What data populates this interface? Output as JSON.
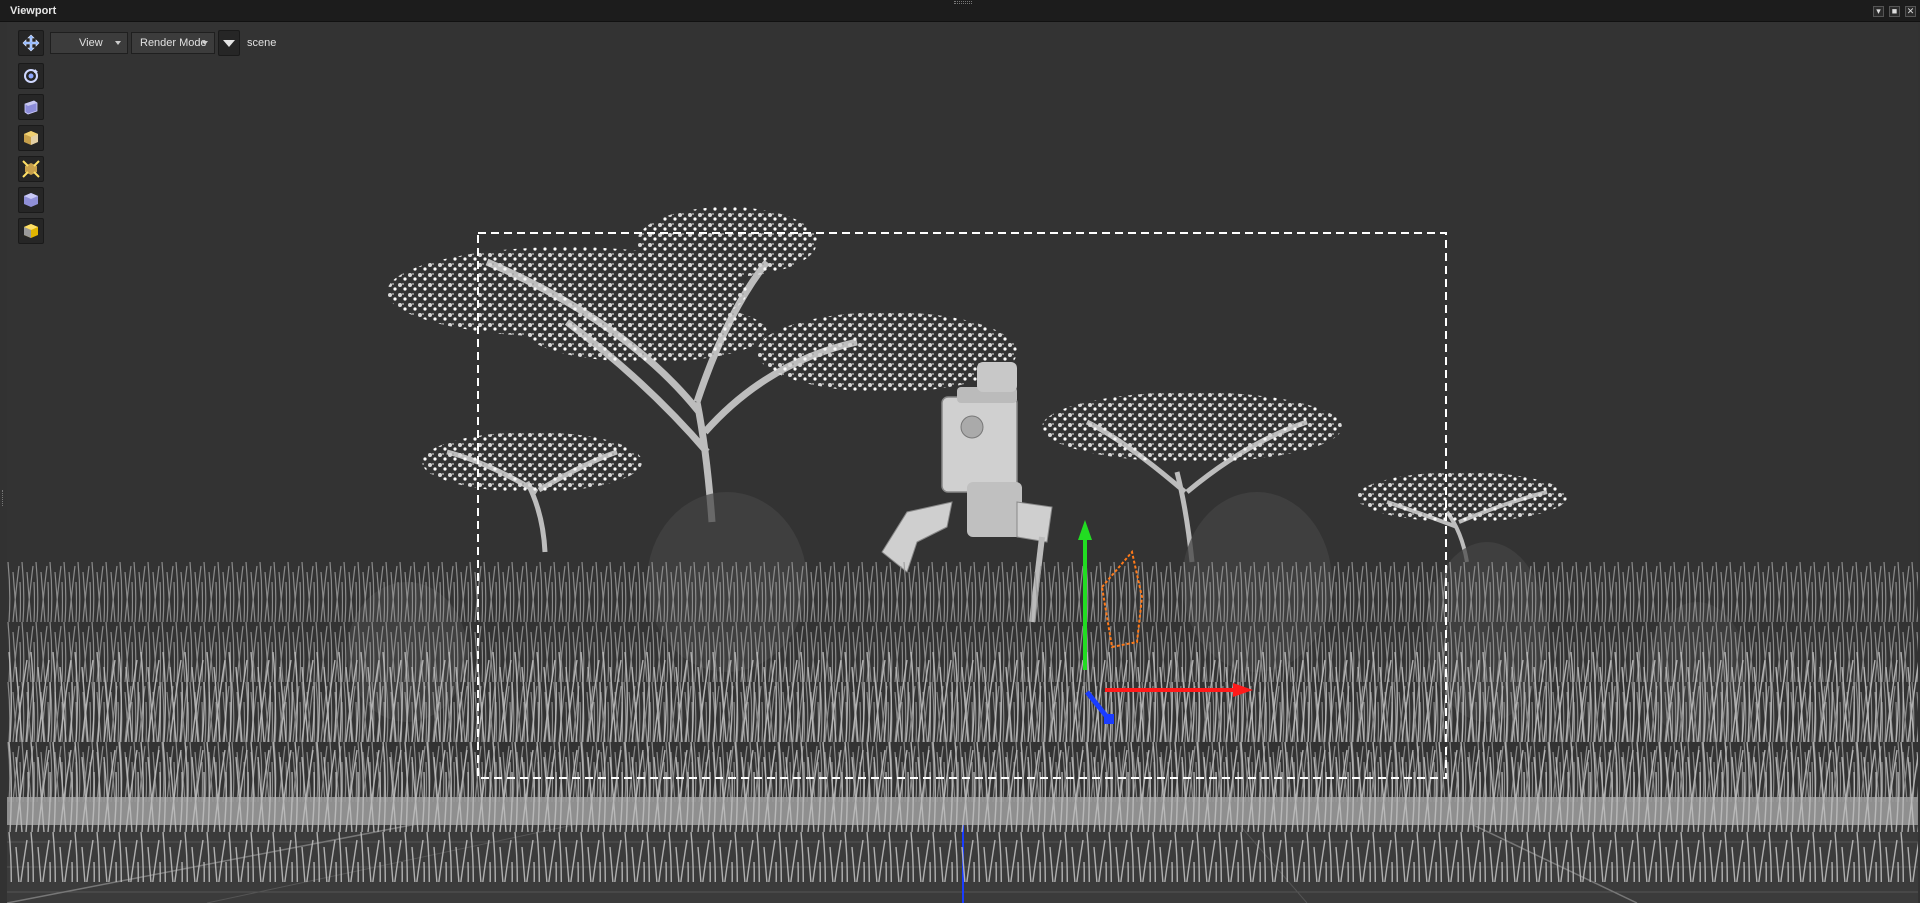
{
  "window": {
    "title": "Viewport",
    "buttons": [
      "▾",
      "■",
      "✕"
    ]
  },
  "toolbar": {
    "view_label": "View",
    "render_mode_label": "Render Mode",
    "scene_label": "scene"
  },
  "side_tools": [
    {
      "name": "orbit-tool-icon"
    },
    {
      "name": "perspective-camera-icon"
    },
    {
      "name": "shaded-cube-icon"
    },
    {
      "name": "textured-cube-icon"
    },
    {
      "name": "lighting-cube-icon"
    },
    {
      "name": "wireframe-cube-icon"
    }
  ],
  "colors": {
    "background": "#333333",
    "gizmo_x": "#ff1a1a",
    "gizmo_y": "#22dd22",
    "gizmo_z": "#1a3cff",
    "selection_outline": "#ff7a1a",
    "safe_frame": "#ffffff"
  }
}
